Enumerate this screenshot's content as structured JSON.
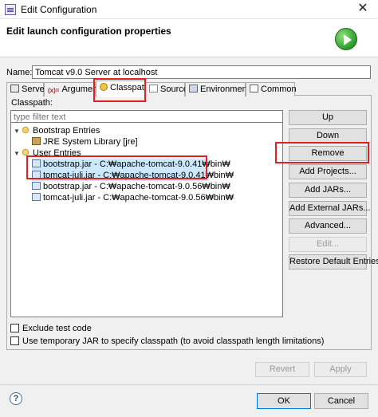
{
  "window": {
    "title": "Edit Configuration",
    "close_glyph": "✕"
  },
  "header": {
    "title": "Edit launch configuration properties",
    "icon": "run-icon"
  },
  "name": {
    "label": "Name:",
    "value": "Tomcat v9.0 Server at localhost"
  },
  "tabs": [
    {
      "label": "Server",
      "icon": "server-icon"
    },
    {
      "label": "Arguments",
      "icon": "arguments-icon"
    },
    {
      "label": "Classpath",
      "icon": "classpath-icon",
      "active": true
    },
    {
      "label": "Source",
      "icon": "source-icon"
    },
    {
      "label": "Environment",
      "icon": "environment-icon"
    },
    {
      "label": "Common",
      "icon": "common-icon"
    }
  ],
  "classpath": {
    "label": "Classpath:",
    "filter_placeholder": "type filter text",
    "tree": [
      {
        "label": "Bootstrap Entries",
        "expander": "▼"
      },
      {
        "label": "JRE System Library [jre]"
      },
      {
        "label": "User Entries",
        "expander": "▼"
      },
      {
        "label": "bootstrap.jar - C:₩apache-tomcat-9.0.41₩bin₩"
      },
      {
        "label": "tomcat-juli.jar - C:₩apache-tomcat-9.0.41₩bin₩"
      },
      {
        "label": "bootstrap.jar - C:₩apache-tomcat-9.0.56₩bin₩"
      },
      {
        "label": "tomcat-juli.jar - C:₩apache-tomcat-9.0.56₩bin₩"
      }
    ]
  },
  "side_buttons": {
    "up": "Up",
    "down": "Down",
    "remove": "Remove",
    "add_projects": "Add Projects...",
    "add_jars": "Add JARs...",
    "add_external_jars": "Add External JARs...",
    "advanced": "Advanced...",
    "edit": "Edit...",
    "restore": "Restore Default Entries"
  },
  "options": {
    "exclude_test_code": "Exclude test code",
    "temp_jar": "Use temporary JAR to specify classpath (to avoid classpath length limitations)"
  },
  "footer": {
    "revert": "Revert",
    "apply": "Apply",
    "ok": "OK",
    "cancel": "Cancel",
    "help_glyph": "?"
  },
  "colors": {
    "highlight": "#e0201f",
    "selection": "#cce8ff"
  }
}
